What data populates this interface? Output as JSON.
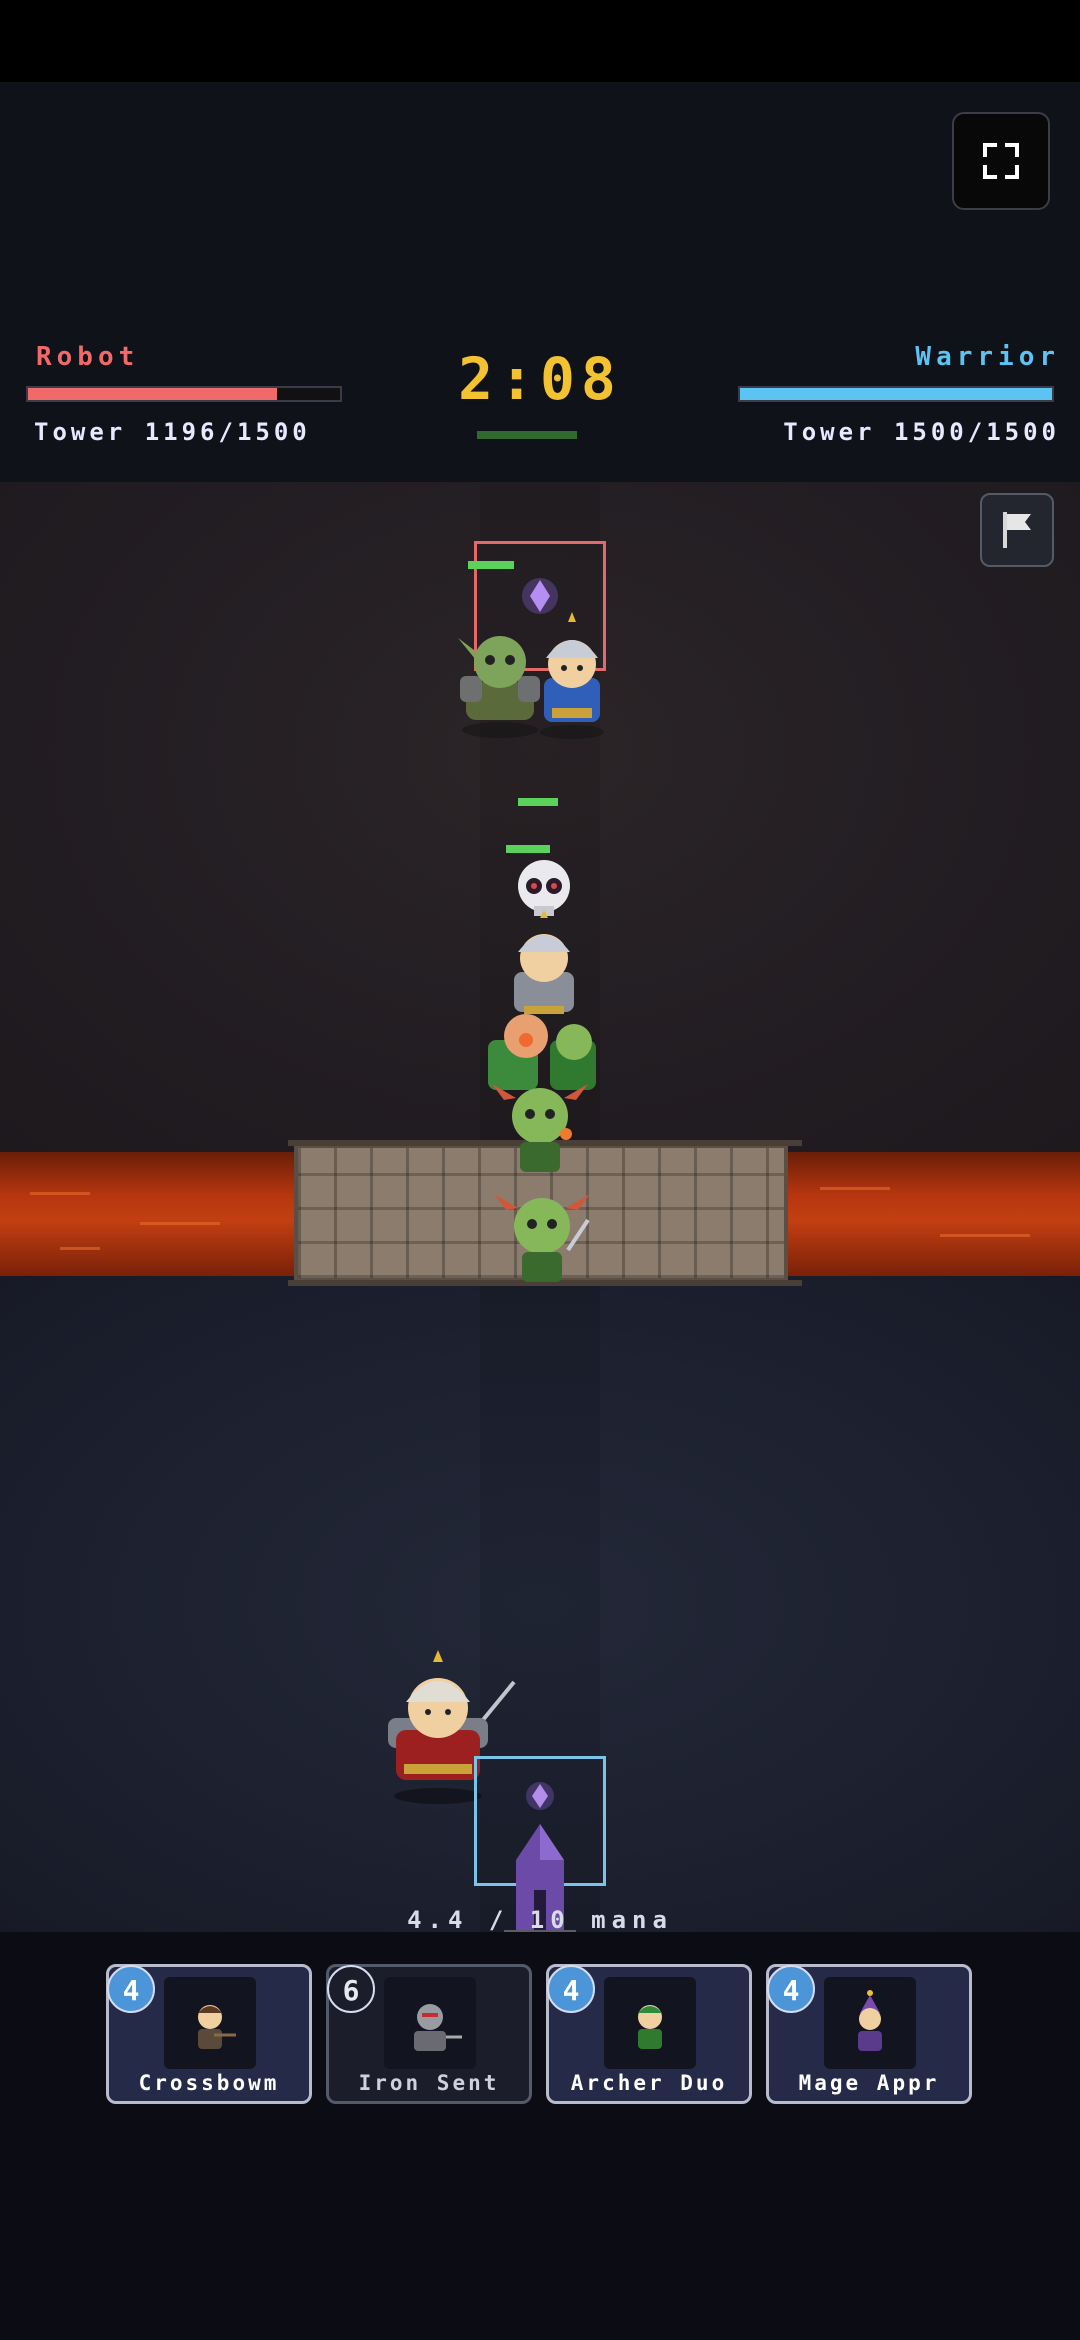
{
  "player_left": {
    "name": "Robot",
    "tower_text": "Tower 1196/1500",
    "tower_hp": 1196,
    "tower_hp_max": 1500,
    "color": "#f06a6a"
  },
  "player_right": {
    "name": "Warrior",
    "tower_text": "Tower 1500/1500",
    "tower_hp": 1500,
    "tower_hp_max": 1500,
    "color": "#5cc4f2"
  },
  "timer": "2:08",
  "mana": {
    "label": "4.4 / 10 mana",
    "current": 4.4,
    "max": 10
  },
  "cards": [
    {
      "name": "Crossbowm",
      "cost": "4",
      "affordable": true,
      "icon": "crossbowman-icon"
    },
    {
      "name": "Iron Sent",
      "cost": "6",
      "affordable": false,
      "icon": "iron-sentinel-icon"
    },
    {
      "name": "Archer Duo",
      "cost": "4",
      "affordable": true,
      "icon": "archer-duo-icon"
    },
    {
      "name": "Mage Appr",
      "cost": "4",
      "affordable": true,
      "icon": "mage-apprentice-icon"
    }
  ],
  "icons": {
    "fullscreen": "fullscreen-icon",
    "surrender": "white-flag-icon"
  }
}
